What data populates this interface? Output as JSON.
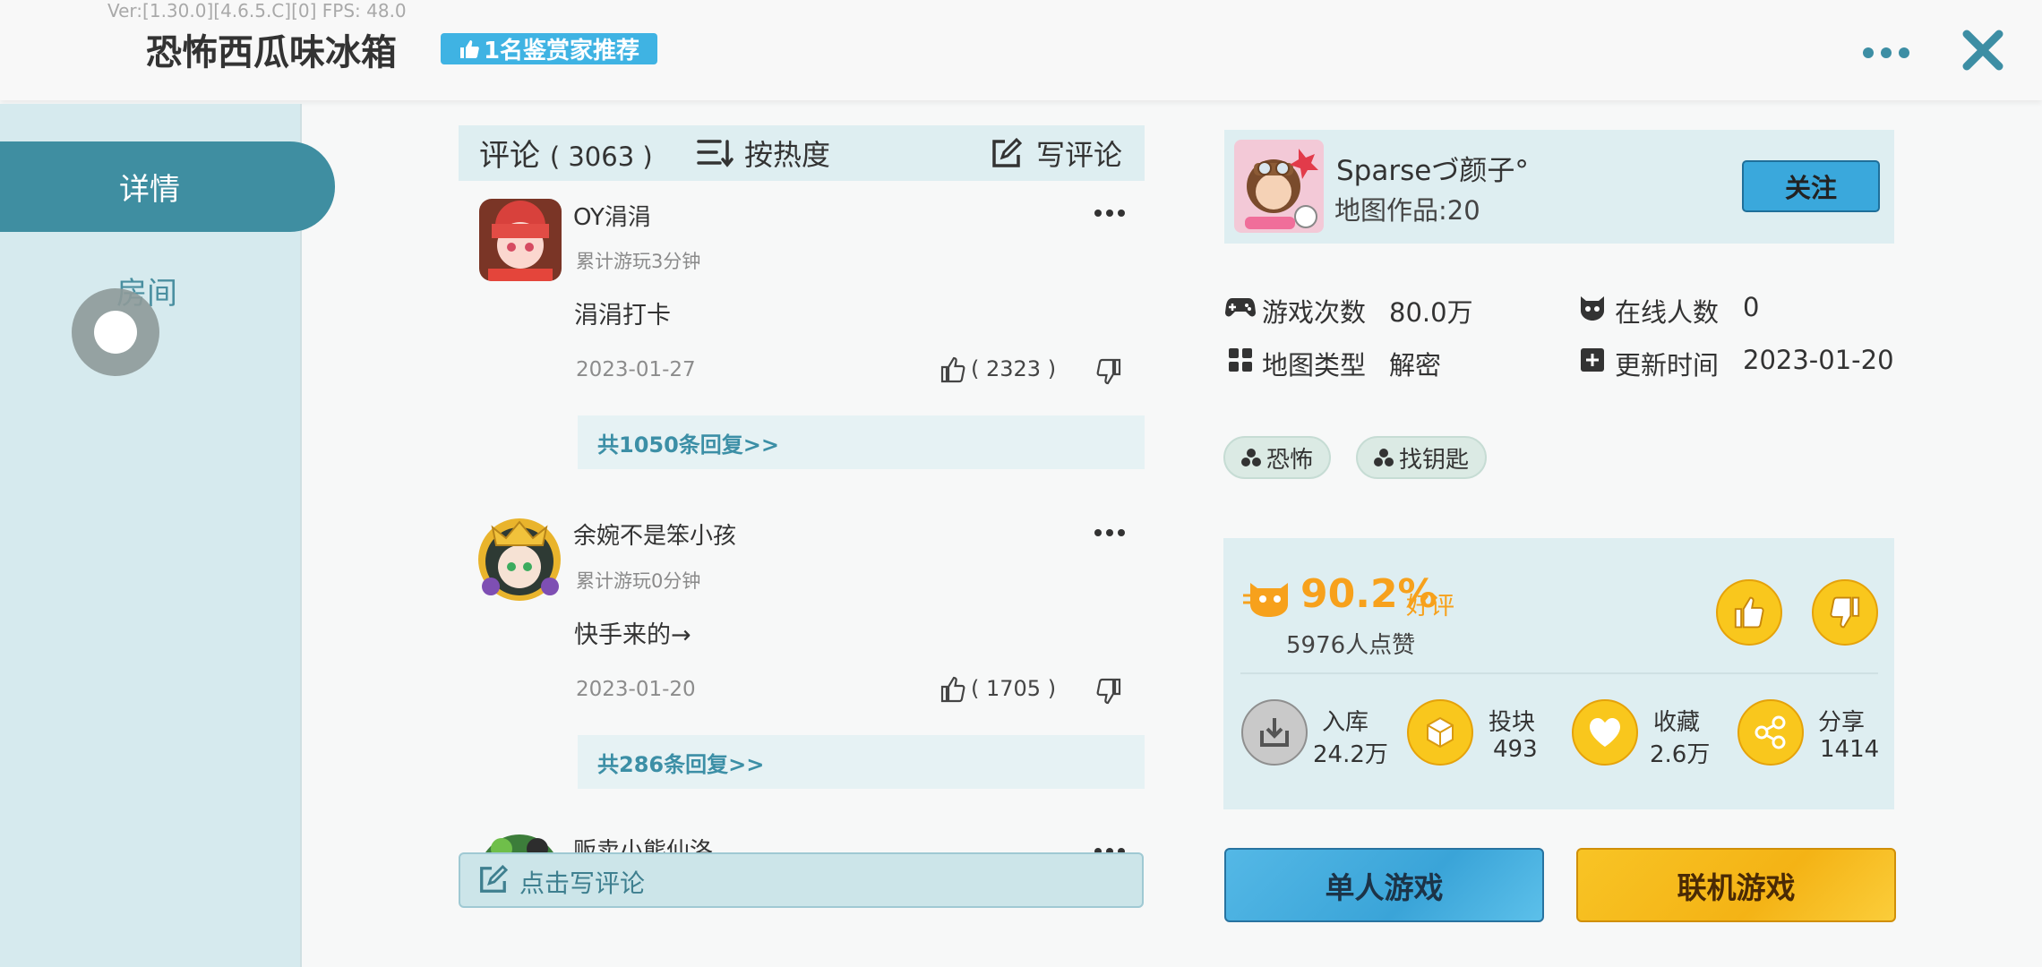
{
  "overlay": {
    "version_text": "Ver:[1.30.0][4.6.5.C][0] FPS: 48.0"
  },
  "header": {
    "title": "恐怖西瓜味冰箱",
    "badge": "1名鉴赏家推荐",
    "more_icon": "more-dots-icon",
    "close_icon": "close-icon"
  },
  "sidebar": {
    "tabs": [
      {
        "label": "详情",
        "active": true
      },
      {
        "label": "房间",
        "active": false
      }
    ]
  },
  "comments": {
    "title": "评论",
    "count": "( 3063 )",
    "sort_label": "按热度",
    "write_label": "写评论",
    "items": [
      {
        "name": "OY涓涓",
        "playtime": "累计游玩3分钟",
        "text": "涓涓打卡",
        "date": "2023-01-27",
        "likes": "( 2323 )",
        "replies": "共1050条回复>>"
      },
      {
        "name": "余婉不是笨小孩",
        "playtime": "累计游玩0分钟",
        "text": "快手来的→",
        "date": "2023-01-20",
        "likes": "( 1705 )",
        "replies": "共286条回复>>"
      },
      {
        "name": "贩卖小熊仙洛"
      }
    ],
    "write_bar_label": "点击写评论"
  },
  "author": {
    "name": "Sparseづ颜子°",
    "works": "地图作品:20",
    "follow_label": "关注"
  },
  "stats": {
    "plays_label": "游戏次数",
    "plays_value": "80.0万",
    "online_label": "在线人数",
    "online_value": "0",
    "type_label": "地图类型",
    "type_value": "解密",
    "updated_label": "更新时间",
    "updated_value": "2023-01-20"
  },
  "tags": [
    "恐怖",
    "找钥匙"
  ],
  "rating": {
    "percent": "90.2%",
    "word": "好评",
    "likes": "5976人点赞"
  },
  "actions": [
    {
      "label": "入库",
      "value": "24.2万",
      "icon": "download-box-icon"
    },
    {
      "label": "投块",
      "value": "493",
      "icon": "block-icon"
    },
    {
      "label": "收藏",
      "value": "2.6万",
      "icon": "heart-icon"
    },
    {
      "label": "分享",
      "value": "1414",
      "icon": "share-icon"
    }
  ],
  "buttons": {
    "single": "单人游戏",
    "multi": "联机游戏"
  },
  "colors": {
    "accent_teal": "#3f8ea1",
    "blue_button": "#3aa8dc",
    "yellow_button": "#f4b315",
    "rating_orange": "#f7a11c"
  }
}
